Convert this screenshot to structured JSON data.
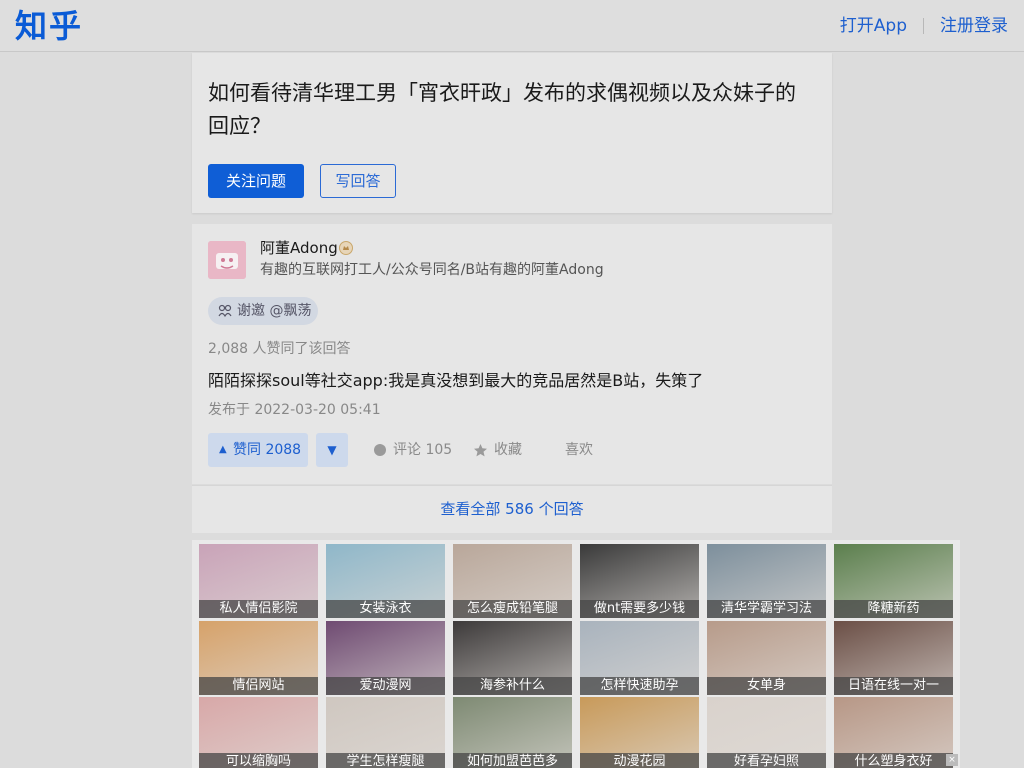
{
  "header": {
    "logo": "知乎",
    "open_app": "打开App",
    "login": "注册登录"
  },
  "question": {
    "title": "如何看待清华理工男「宵衣旰政」发布的求偶视频以及众妹子的回应？",
    "follow_label": "关注问题",
    "write_label": "写回答"
  },
  "answer": {
    "author_name": "阿董Adong",
    "author_bio": "有趣的互联网打工人/公众号同名/B站有趣的阿董Adong",
    "invite": "谢邀 @飘荡",
    "vote_count": "2,088 人赞同了该回答",
    "text": "陌陌探探soul等社交app:我是真没想到最大的竞品居然是B站，失策了",
    "published": "发布于 2022-03-20 05:41",
    "upvote_label": "赞同 2088",
    "comment_label": "评论 105",
    "collect_label": "收藏",
    "like_label": "喜欢"
  },
  "view_all": "查看全部 586 个回答",
  "ads": [
    {
      "caption": "私人情侣影院",
      "color": "#c9a3b8"
    },
    {
      "caption": "女装泳衣",
      "color": "#8fb7c9"
    },
    {
      "caption": "怎么瘦成铅笔腿",
      "color": "#b9a79a"
    },
    {
      "caption": "做nt需要多少钱",
      "color": "#3a3a3a"
    },
    {
      "caption": "清华学霸学习法",
      "color": "#7d8f9c"
    },
    {
      "caption": "降糖新药",
      "color": "#5b7f4d"
    },
    {
      "caption": "情侣网站",
      "color": "#d6a26a"
    },
    {
      "caption": "爱动漫网",
      "color": "#6f4b72"
    },
    {
      "caption": "海参补什么",
      "color": "#3d3a3a"
    },
    {
      "caption": "怎样快速助孕",
      "color": "#a9b3bd"
    },
    {
      "caption": "女单身",
      "color": "#b79b8a"
    },
    {
      "caption": "日语在线一对一",
      "color": "#6b4f46"
    },
    {
      "caption": "可以缩胸吗",
      "color": "#d8a8a8"
    },
    {
      "caption": "学生怎样瘦腿",
      "color": "#cfc7c0"
    },
    {
      "caption": "如何加盟芭芭多",
      "color": "#7e8a73"
    },
    {
      "caption": "动漫花园",
      "color": "#c89a5a"
    },
    {
      "caption": "好看孕妇照",
      "color": "#d9d2cc"
    },
    {
      "caption": "什么塑身衣好",
      "color": "#b79786"
    }
  ]
}
